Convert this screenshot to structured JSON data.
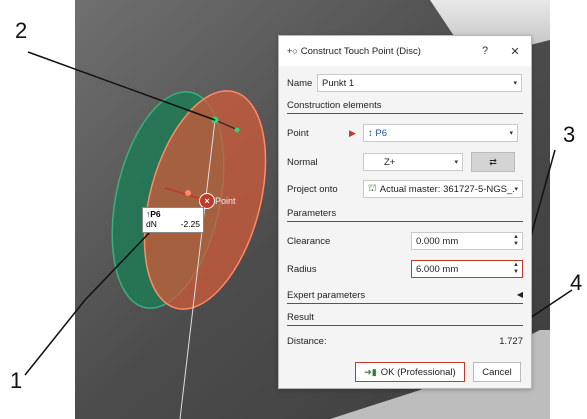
{
  "callouts": [
    "2",
    "3",
    "4",
    "1"
  ],
  "tooltip": {
    "point": "↑P6",
    "key": "dN",
    "value": "-2.25"
  },
  "viewport_label": "Point",
  "dialog": {
    "title": "Construct Touch Point (Disc)",
    "help": "?",
    "close": "✕",
    "name_label": "Name",
    "name_value": "Punkt 1",
    "construction_header": "Construction elements",
    "point_label": "Point",
    "point_value": "↕ P6",
    "normal_label": "Normal",
    "normal_value": "Z+",
    "project_label": "Project onto",
    "project_value": "Actual master: 361727-5-NGS_...",
    "parameters_header": "Parameters",
    "clearance_label": "Clearance",
    "clearance_value": "0.000 mm",
    "radius_label": "Radius",
    "radius_value": "6.000 mm",
    "expert_header": "Expert parameters",
    "result_header": "Result",
    "distance_label": "Distance:",
    "distance_value": "1.727",
    "ok_label": "OK (Professional)",
    "cancel_label": "Cancel"
  },
  "colors": {
    "accent_red": "#c0392b",
    "disc_green": "#1f7a55",
    "disc_orange": "#e06a45"
  }
}
